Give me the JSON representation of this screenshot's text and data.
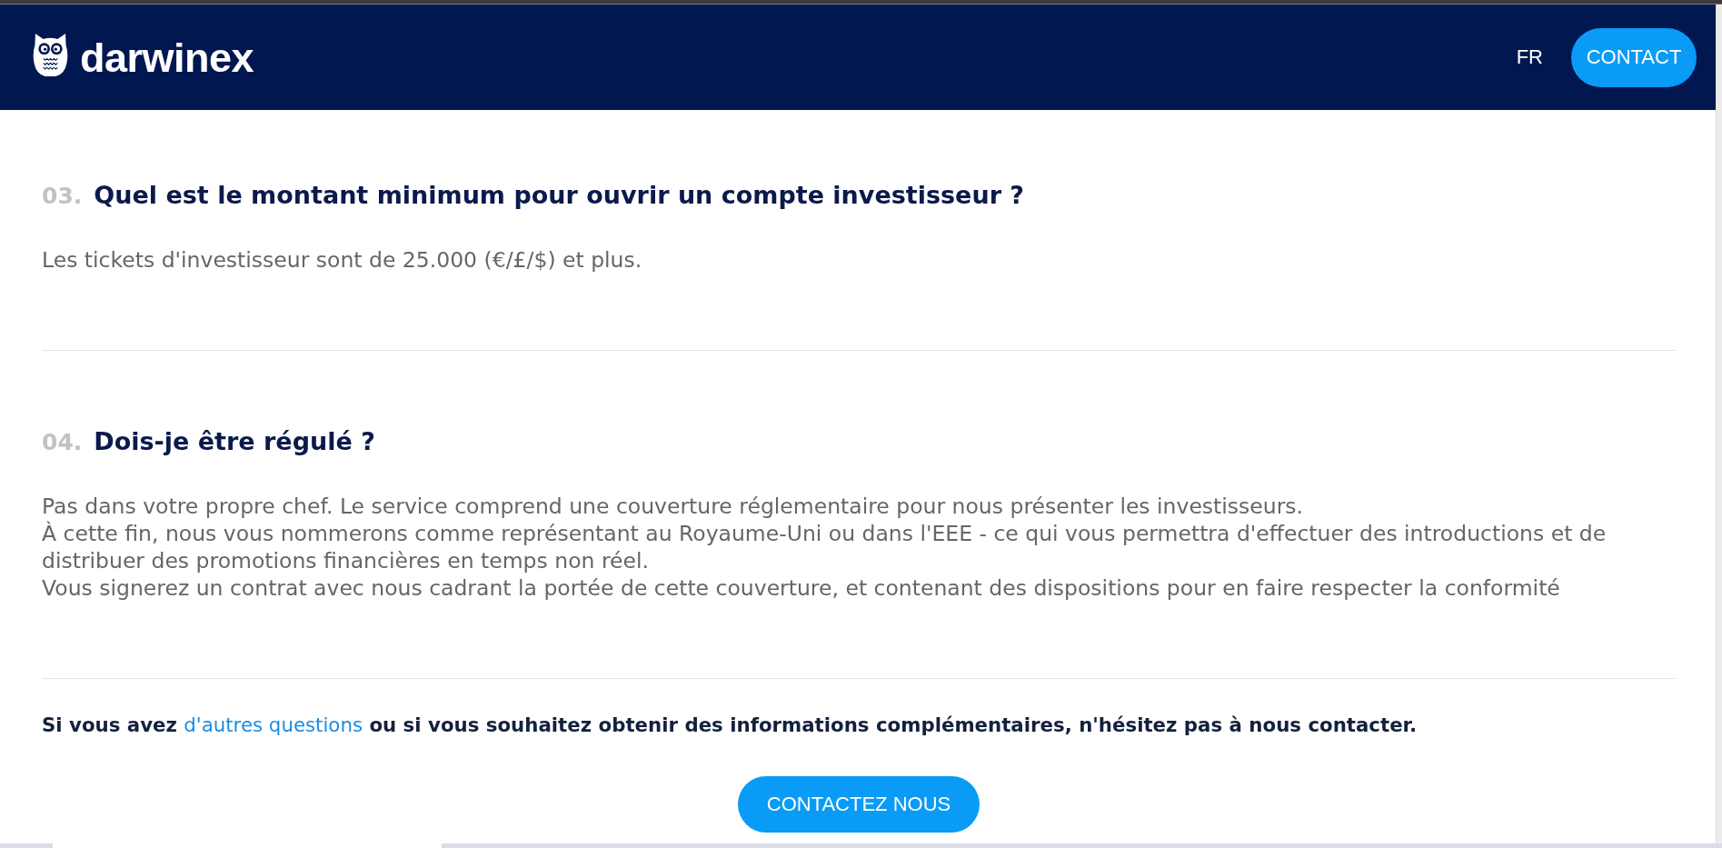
{
  "header": {
    "logo": "darwinex",
    "language": "FR",
    "contact_button": "CONTACT"
  },
  "faq": [
    {
      "number": "03.",
      "question": "Quel est le montant minimum pour ouvrir un compte investisseur ?",
      "answer": [
        "Les tickets d'investisseur sont de 25.000 (€/£/$) et plus."
      ]
    },
    {
      "number": "04.",
      "question": "Dois-je être régulé ?",
      "answer": [
        "Pas dans votre propre chef. Le service comprend une couverture réglementaire pour nous présenter les investisseurs.",
        "À cette fin, nous vous nommerons comme représentant au Royaume-Uni ou dans l'EEE - ce qui vous permettra d'effectuer des introductions et de distribuer des promotions financières en temps non réel.",
        "Vous signerez un contrat avec nous cadrant la portée de cette couverture, et contenant des dispositions pour en faire respecter la conformité"
      ]
    }
  ],
  "footer": {
    "text_before": "Si vous avez",
    "link": "d'autres questions",
    "text_after": "ou si vous souhaitez obtenir des informations complémentaires, n'hésitez pas à nous contacter.",
    "button": "CONTACTEZ NOUS"
  }
}
